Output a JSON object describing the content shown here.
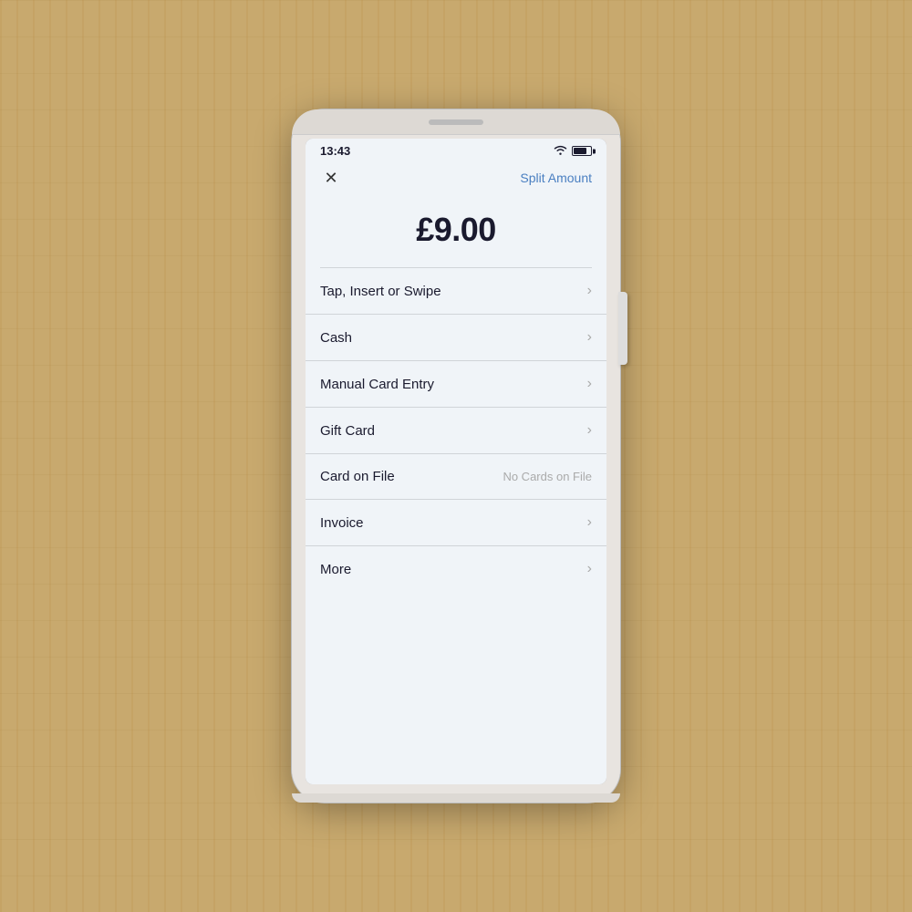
{
  "device": {
    "status_bar": {
      "time": "13:43"
    },
    "header": {
      "close_label": "✕",
      "split_amount_label": "Split Amount"
    },
    "amount": {
      "value": "£9.00"
    },
    "payment_methods": [
      {
        "id": "tap-insert-swipe",
        "label": "Tap, Insert or Swipe",
        "sublabel": "",
        "has_chevron": true
      },
      {
        "id": "cash",
        "label": "Cash",
        "sublabel": "",
        "has_chevron": true
      },
      {
        "id": "manual-card-entry",
        "label": "Manual Card Entry",
        "sublabel": "",
        "has_chevron": true
      },
      {
        "id": "gift-card",
        "label": "Gift Card",
        "sublabel": "",
        "has_chevron": true
      },
      {
        "id": "card-on-file",
        "label": "Card on File",
        "sublabel": "No Cards on File",
        "has_chevron": false
      },
      {
        "id": "invoice",
        "label": "Invoice",
        "sublabel": "",
        "has_chevron": true
      },
      {
        "id": "more",
        "label": "More",
        "sublabel": "",
        "has_chevron": true
      }
    ]
  }
}
